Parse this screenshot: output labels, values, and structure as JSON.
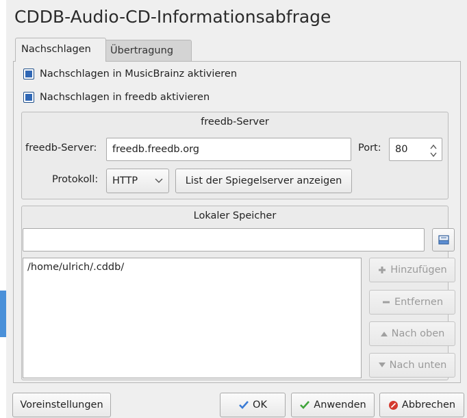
{
  "dialog": {
    "title": "CDDB-Audio-CD-Informationsabfrage"
  },
  "tabs": [
    {
      "label": "Nachschlagen",
      "active": true
    },
    {
      "label": "Übertragung",
      "active": false
    }
  ],
  "lookup": {
    "musicbrainz": {
      "label": "Nachschlagen in MusicBrainz aktivieren",
      "checked": true
    },
    "freedb": {
      "label": "Nachschlagen in freedb aktivieren",
      "checked": true
    }
  },
  "freedb_group": {
    "title": "freedb-Server",
    "server_label": "freedb-Server:",
    "server_value": "freedb.freedb.org",
    "port_label": "Port:",
    "port_value": "80",
    "protocol_label": "Protokoll:",
    "protocol_value": "HTTP",
    "mirror_button": "List der Spiegelserver anzeigen"
  },
  "local_group": {
    "title": "Lokaler Speicher",
    "path_input_value": "",
    "paths": [
      "/home/ulrich/.cddb/"
    ],
    "buttons": {
      "add": "Hinzufügen",
      "remove": "Entfernen",
      "up": "Nach oben",
      "down": "Nach unten"
    }
  },
  "footer": {
    "defaults": "Voreinstellungen",
    "ok": "OK",
    "apply": "Anwenden",
    "cancel": "Abbrechen"
  },
  "colors": {
    "accent": "#4a90d9",
    "checkbox": "#2f67b5",
    "ok_check": "#3a7bd5",
    "apply_check": "#3fa43a",
    "cancel_icon": "#d43a2f"
  }
}
